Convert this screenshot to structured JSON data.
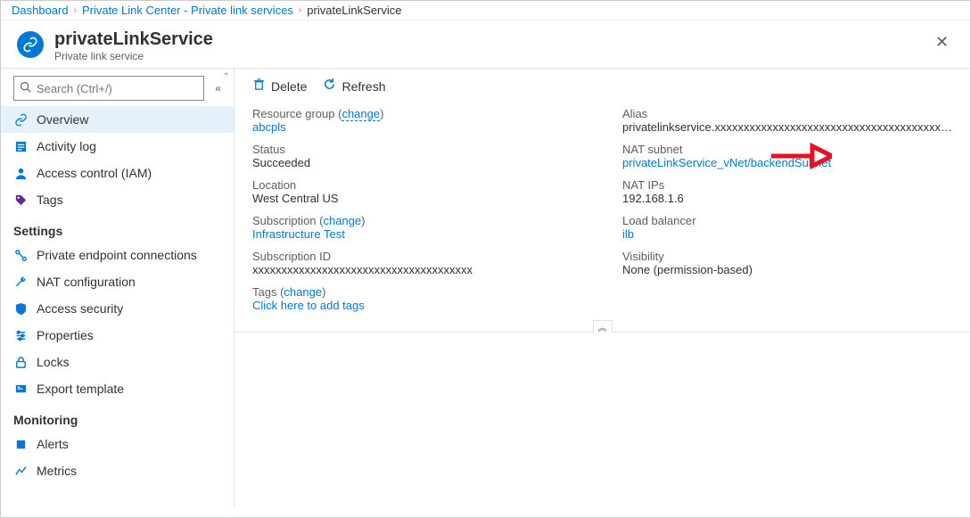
{
  "breadcrumb": {
    "items": [
      {
        "label": "Dashboard"
      },
      {
        "label": "Private Link Center - Private link services"
      },
      {
        "label": "privateLinkService"
      }
    ]
  },
  "header": {
    "title": "privateLinkService",
    "subtitle": "Private link service",
    "close_tooltip": "Close"
  },
  "sidebar": {
    "search_placeholder": "Search (Ctrl+/)",
    "groups": [
      {
        "header": null,
        "items": [
          {
            "label": "Overview",
            "icon": "link-icon",
            "selected": true
          },
          {
            "label": "Activity log",
            "icon": "log-icon"
          },
          {
            "label": "Access control (IAM)",
            "icon": "person-icon"
          },
          {
            "label": "Tags",
            "icon": "tag-icon"
          }
        ]
      },
      {
        "header": "Settings",
        "items": [
          {
            "label": "Private endpoint connections",
            "icon": "connections-icon"
          },
          {
            "label": "NAT configuration",
            "icon": "wrench-icon"
          },
          {
            "label": "Access security",
            "icon": "shield-icon"
          },
          {
            "label": "Properties",
            "icon": "properties-icon"
          },
          {
            "label": "Locks",
            "icon": "lock-icon"
          },
          {
            "label": "Export template",
            "icon": "export-icon"
          }
        ]
      },
      {
        "header": "Monitoring",
        "items": [
          {
            "label": "Alerts",
            "icon": "alert-icon"
          },
          {
            "label": "Metrics",
            "icon": "metrics-icon"
          }
        ]
      }
    ]
  },
  "toolbar": {
    "delete_label": "Delete",
    "refresh_label": "Refresh"
  },
  "essentials": {
    "left": {
      "resource_group_label": "Resource group",
      "resource_group_change": "change",
      "resource_group_value": "abcpls",
      "status_label": "Status",
      "status_value": "Succeeded",
      "location_label": "Location",
      "location_value": "West Central US",
      "subscription_label": "Subscription",
      "subscription_change": "change",
      "subscription_value": "Infrastructure Test",
      "subscription_id_label": "Subscription ID",
      "subscription_id_value": "xxxxxxxxxxxxxxxxxxxxxxxxxxxxxxxxxxxxxx",
      "tags_label": "Tags",
      "tags_change": "change",
      "tags_value": "Click here to add tags"
    },
    "right": {
      "alias_label": "Alias",
      "alias_value": "privatelinkservice.xxxxxxxxxxxxxxxxxxxxxxxxxxxxxxxxxxxxxxxxxxxxx",
      "nat_subnet_label": "NAT subnet",
      "nat_subnet_value": "privateLinkService_vNet/backendSubnet",
      "nat_ips_label": "NAT IPs",
      "nat_ips_value": "192.168.1.6",
      "load_balancer_label": "Load balancer",
      "load_balancer_value": "ilb",
      "visibility_label": "Visibility",
      "visibility_value": "None (permission-based)"
    }
  }
}
